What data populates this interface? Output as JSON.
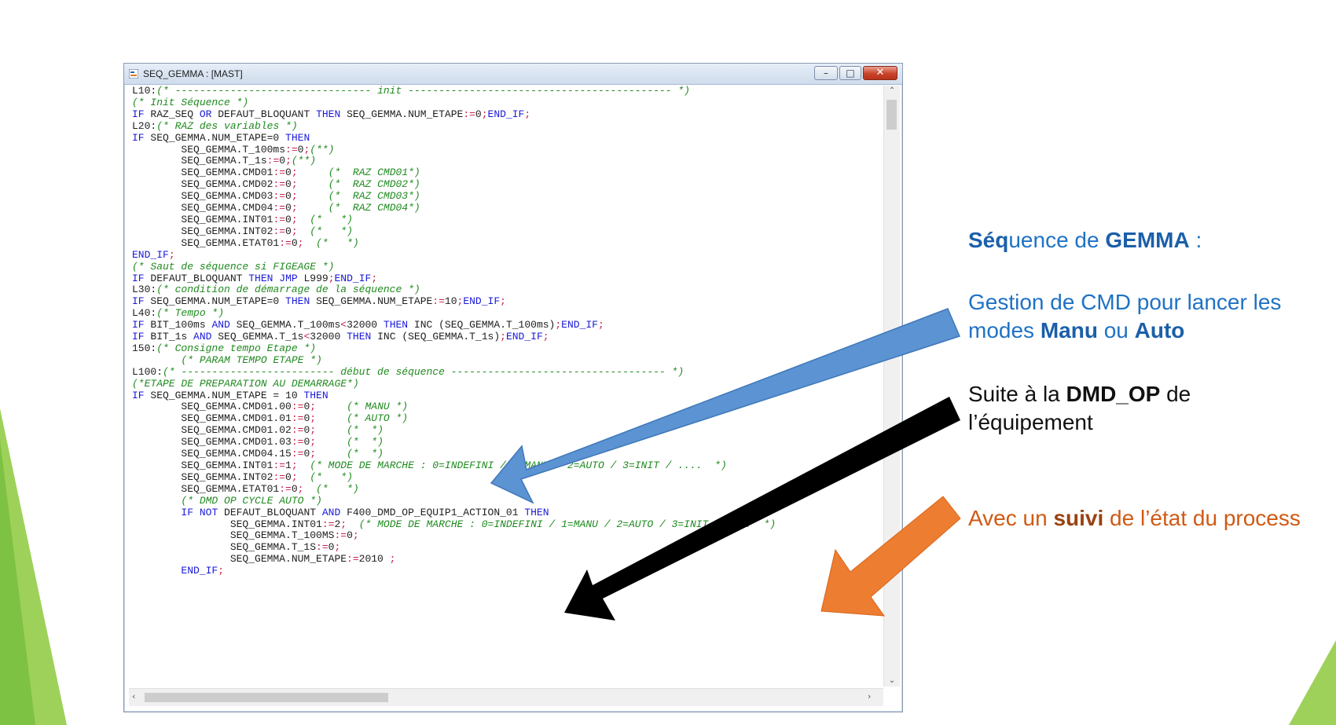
{
  "window": {
    "title": "SEQ_GEMMA : [MAST]",
    "icon": "program-icon",
    "controls": {
      "minimize_icon": "minimize-icon",
      "maximize_icon": "maximize-icon",
      "close_icon": "close-icon"
    }
  },
  "code": [
    "L10:(* -------------------------------- init ------------------------------------------- *)",
    "(* Init Séquence *)",
    "IF RAZ_SEQ OR DEFAUT_BLOQUANT THEN SEQ_GEMMA.NUM_ETAPE:=0;END_IF;",
    "L20:(* RAZ des variables *)",
    "IF SEQ_GEMMA.NUM_ETAPE=0 THEN",
    "        SEQ_GEMMA.T_100ms:=0;(**)",
    "        SEQ_GEMMA.T_1s:=0;(**)",
    "        SEQ_GEMMA.CMD01:=0;     (*  RAZ CMD01*)",
    "        SEQ_GEMMA.CMD02:=0;     (*  RAZ CMD02*)",
    "        SEQ_GEMMA.CMD03:=0;     (*  RAZ CMD03*)",
    "        SEQ_GEMMA.CMD04:=0;     (*  RAZ CMD04*)",
    "        SEQ_GEMMA.INT01:=0;  (*   *)",
    "        SEQ_GEMMA.INT02:=0;  (*   *)",
    "        SEQ_GEMMA.ETAT01:=0;  (*   *)",
    "END_IF;",
    "(* Saut de séquence si FIGEAGE *)",
    "IF DEFAUT_BLOQUANT THEN JMP L999;END_IF;",
    "L30:(* condition de démarrage de la séquence *)",
    "IF SEQ_GEMMA.NUM_ETAPE=0 THEN SEQ_GEMMA.NUM_ETAPE:=10;END_IF;",
    "L40:(* Tempo *)",
    "IF BIT_100ms AND SEQ_GEMMA.T_100ms<32000 THEN INC (SEQ_GEMMA.T_100ms);END_IF;",
    "IF BIT_1s AND SEQ_GEMMA.T_1s<32000 THEN INC (SEQ_GEMMA.T_1s);END_IF;",
    "150:(* Consigne tempo Etape *)",
    "        (* PARAM TEMPO ETAPE *)",
    "L100:(* ------------------------- début de séquence ----------------------------------- *)",
    "(*ETAPE DE PREPARATION AU DEMARRAGE*)",
    "IF SEQ_GEMMA.NUM_ETAPE = 10 THEN",
    "        SEQ_GEMMA.CMD01.00:=0;     (* MANU *)",
    "        SEQ_GEMMA.CMD01.01:=0;     (* AUTO *)",
    "        SEQ_GEMMA.CMD01.02:=0;     (*  *)",
    "        SEQ_GEMMA.CMD01.03:=0;     (*  *)",
    "        SEQ_GEMMA.CMD04.15:=0;     (*  *)",
    "        SEQ_GEMMA.INT01:=1;  (* MODE DE MARCHE : 0=INDEFINI / 1=MANU / 2=AUTO / 3=INIT / ....  *)",
    "        SEQ_GEMMA.INT02:=0;  (*   *)",
    "        SEQ_GEMMA.ETAT01:=0;  (*   *)",
    "        (* DMD OP CYCLE AUTO *)",
    "        IF NOT DEFAUT_BLOQUANT AND F400_DMD_OP_EQUIP1_ACTION_01 THEN",
    "                SEQ_GEMMA.INT01:=2;  (* MODE DE MARCHE : 0=INDEFINI / 1=MANU / 2=AUTO / 3=INIT / ....  *)",
    "                SEQ_GEMMA.T_100MS:=0;",
    "                SEQ_GEMMA.T_1S:=0;",
    "                SEQ_GEMMA.NUM_ETAPE:=2010 ;",
    "        END_IF;"
  ],
  "annotations": {
    "seq_pre": "Séq",
    "seq_mid": "uence de ",
    "seq_bold": "GEMMA",
    "seq_post": " :",
    "gestion_1": "Gestion de CMD  pour lancer les",
    "gestion_2a": "modes ",
    "gestion_manu": "Manu",
    "gestion_2b": " ou ",
    "gestion_auto": "Auto",
    "suite_pre": "Suite à la ",
    "suite_bold": "DMD_OP",
    "suite_post": " de",
    "suite_2": "l’équipement",
    "avec_pre": "Avec un ",
    "avec_bold": "suivi",
    "avec_post": " de l’état du process"
  },
  "colors": {
    "blue_text": "#1f72c4",
    "blue_arrow": "#5b93d3",
    "black_arrow": "#000000",
    "orange_arrow": "#ed7d31",
    "green_deco": "#7dc242",
    "keyword": "#1a1ad8",
    "comment": "#1f8a1f"
  }
}
